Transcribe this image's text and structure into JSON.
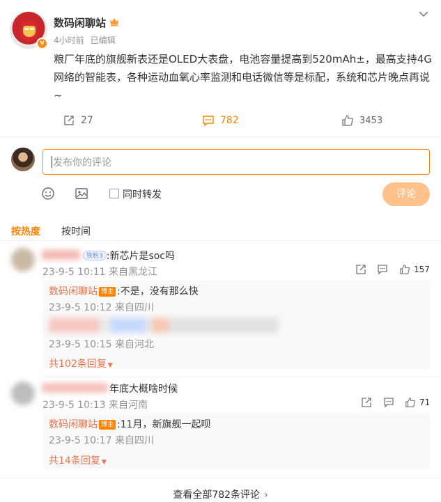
{
  "post": {
    "author": "数码闲聊站",
    "time": "4小时前",
    "edited": "已编辑",
    "vip_icon": "v",
    "text": "粮厂年底的旗舰新表还是OLED大表盘，电池容量提高到520mAh±，最高支持4G网络的智能表，各种运动血氧心率监测和电话微信等是标配，系统和芯片晚点再说~",
    "reposts": "27",
    "comments": "782",
    "likes": "3453"
  },
  "composer": {
    "placeholder": "发布你的评论",
    "repost_label": "同时转发",
    "submit_label": "评论"
  },
  "sort": {
    "hot": "按热度",
    "time": "按时间"
  },
  "comments": [
    {
      "fans_badge": "铁粉3",
      "text": ":新芯片是soc吗",
      "time": "23-9-5 10:11",
      "location": "来自黑龙江",
      "likes": "157",
      "replies": [
        {
          "name": "数码闲聊站",
          "tag": "博主",
          "text": ":不是，没有那么快",
          "time": "23-9-5 10:12",
          "location": "来自四川"
        },
        {
          "time": "23-9-5 10:15",
          "location": "来自河北"
        }
      ],
      "more": "共102条回复"
    },
    {
      "text": "年底大概啥时候",
      "time": "23-9-5 10:13",
      "location": "来自河南",
      "likes": "71",
      "replies": [
        {
          "name": "数码闲聊站",
          "tag": "博主",
          "text": ":11月，新旗舰一起呗",
          "time": "23-9-5 10:17",
          "location": "来自四川"
        }
      ],
      "more": "共14条回复"
    }
  ],
  "footer": {
    "view_all": "查看全部782条评论"
  },
  "colors": {
    "accent": "#ff8200",
    "reply_name": "#eb7350",
    "meta": "#939393"
  }
}
